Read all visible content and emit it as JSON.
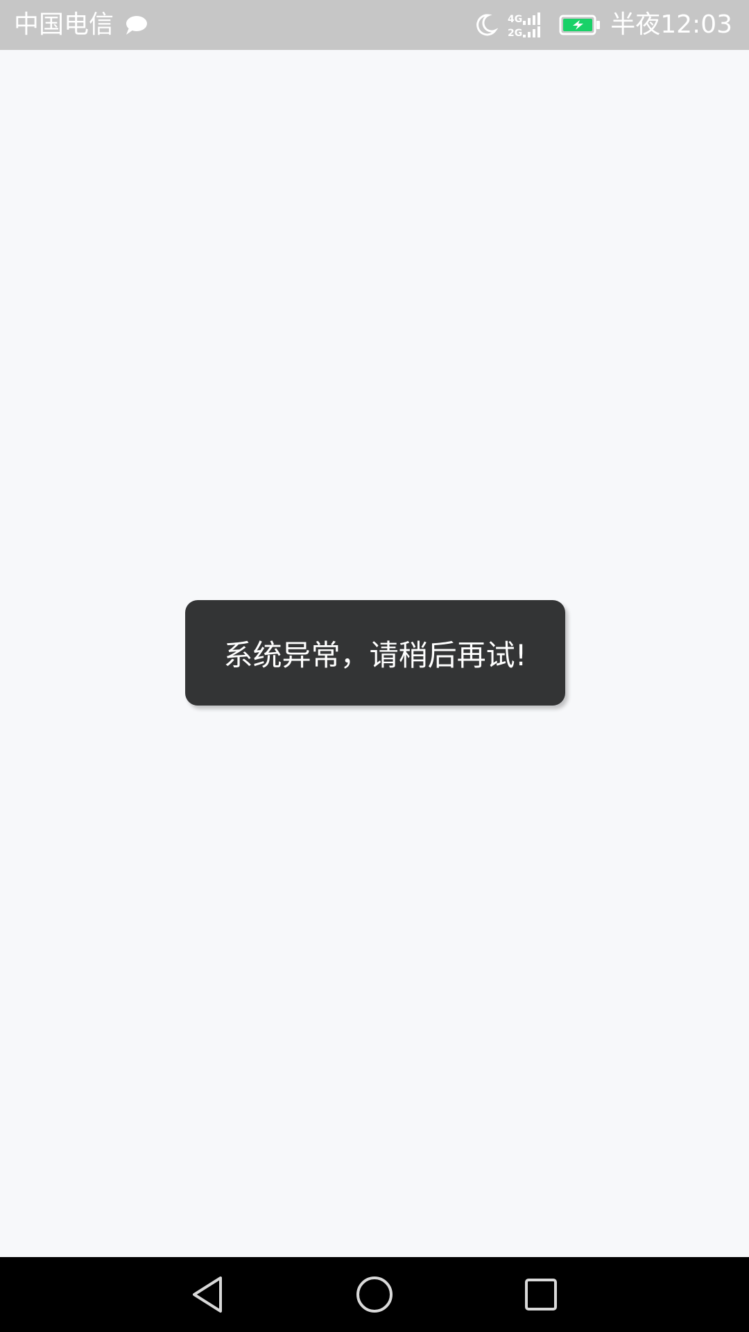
{
  "status_bar": {
    "carrier": "中国电信",
    "network_label_top": "4G",
    "network_label_bottom": "2G",
    "time": "半夜12:03",
    "battery_color": "#19d168",
    "icons": [
      "message-icon",
      "moon-icon",
      "signal-icon",
      "battery-charging-icon"
    ]
  },
  "toast": {
    "message": "系统异常，请稍后再试!"
  },
  "nav_bar": {
    "icons": [
      "back-icon",
      "home-icon",
      "recents-icon"
    ]
  }
}
